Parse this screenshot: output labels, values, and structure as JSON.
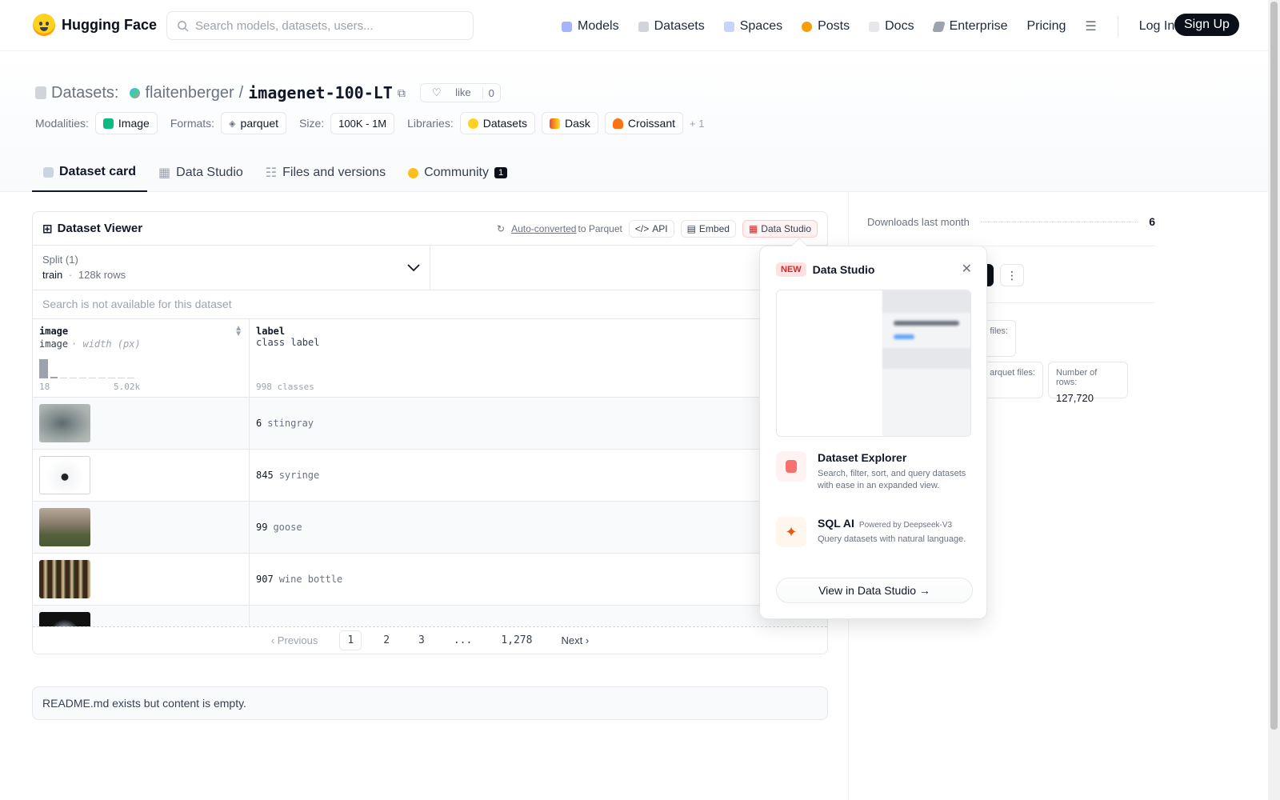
{
  "nav": {
    "brand": "Hugging Face",
    "search_placeholder": "Search models, datasets, users...",
    "links": [
      "Models",
      "Datasets",
      "Spaces",
      "Posts",
      "Docs",
      "Enterprise",
      "Pricing"
    ],
    "login": "Log In",
    "signup": "Sign Up"
  },
  "header": {
    "section": "Datasets:",
    "owner": "flaitenberger",
    "slash": "/",
    "repo": "imagenet-100-LT",
    "like_label": "like",
    "like_count": "0",
    "modalities_label": "Modalities:",
    "modality": "Image",
    "formats_label": "Formats:",
    "format": "parquet",
    "size_label": "Size:",
    "size": "100K - 1M",
    "libraries_label": "Libraries:",
    "libraries": [
      "Datasets",
      "Dask",
      "Croissant"
    ],
    "more_libraries": "+ 1"
  },
  "tabs": {
    "card": "Dataset card",
    "studio": "Data Studio",
    "files": "Files and versions",
    "community": "Community",
    "community_count": "1"
  },
  "viewer": {
    "title": "Dataset Viewer",
    "auto_converted": "Auto-converted",
    "to_parquet": "to Parquet",
    "api": "API",
    "embed": "Embed",
    "data_studio": "Data Studio",
    "split_label": "Split (1)",
    "split_name": "train",
    "split_dot": "·",
    "split_rows": "128k rows",
    "search_disabled": "Search is not available for this dataset",
    "col1_name": "image",
    "col1_type": "image",
    "col1_sub": "· width (px)",
    "col1_min": "18",
    "col1_max": "5.02k",
    "col2_name": "label",
    "col2_type": "class label",
    "col2_classes": "998 classes",
    "rows": [
      {
        "id": "6",
        "name": "stingray"
      },
      {
        "id": "845",
        "name": "syringe"
      },
      {
        "id": "99",
        "name": "goose"
      },
      {
        "id": "907",
        "name": "wine bottle"
      }
    ],
    "pager": {
      "prev": "Previous",
      "p1": "1",
      "p2": "2",
      "p3": "3",
      "ellipsis": "...",
      "last": "1,278",
      "next": "Next"
    }
  },
  "readme": "README.md exists but content is empty.",
  "sidebar": {
    "downloads_label": "Downloads last month",
    "downloads": "6",
    "files_label": "files:",
    "parquet_label": "arquet files:",
    "rows_label": "Number of rows:",
    "rows_value": "127,720"
  },
  "popover": {
    "badge": "NEW",
    "title": "Data Studio",
    "f1_title": "Dataset Explorer",
    "f1_desc": "Search, filter, sort, and query datasets with ease in an expanded view.",
    "f2_title": "SQL AI",
    "f2_powered": "Powered by Deepseek-V3",
    "f2_desc": "Query datasets with natural language.",
    "cta": "View in Data Studio →"
  },
  "colors": {
    "accent_dark": "#0b0f19",
    "brand_yellow": "#ffd21e",
    "data_studio_red": "#dc2626"
  }
}
